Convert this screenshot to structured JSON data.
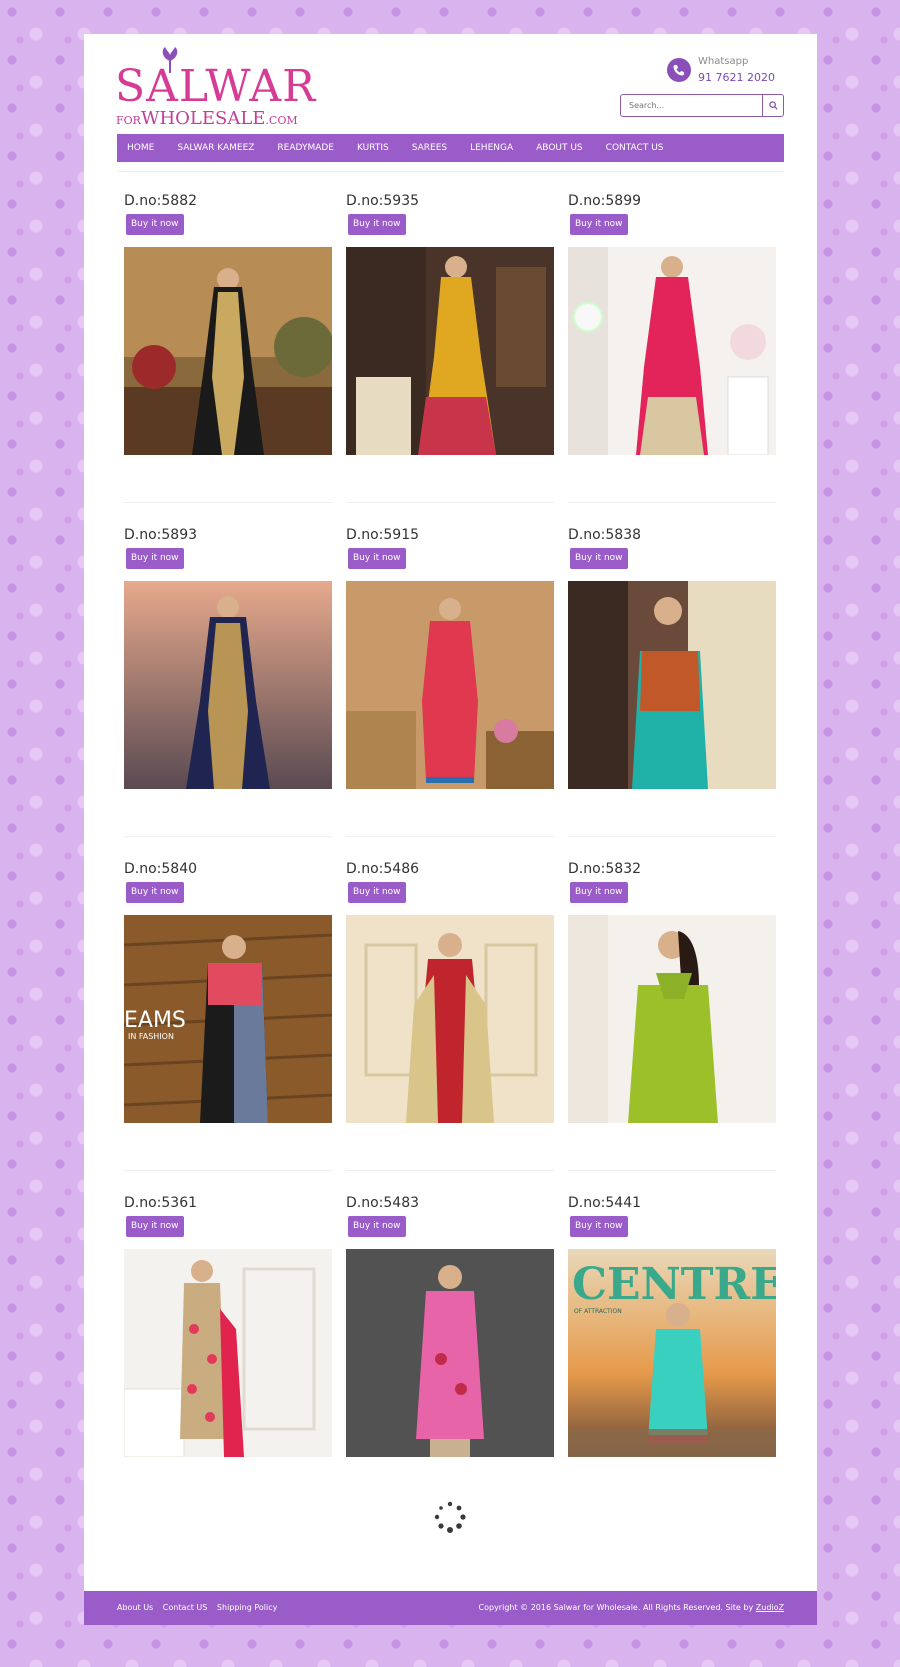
{
  "brand": {
    "logo_main": "SALWAR",
    "logo_prefix": "FOR",
    "logo_sub": "WHOLESALE",
    "logo_suffix": ".COM"
  },
  "contact": {
    "label": "Whatsapp",
    "number": "91 7621 2020"
  },
  "search": {
    "placeholder": "Search..."
  },
  "nav": {
    "items": [
      {
        "label": "HOME"
      },
      {
        "label": "SALWAR KAMEEZ"
      },
      {
        "label": "READYMADE"
      },
      {
        "label": "KURTIS"
      },
      {
        "label": "SAREES"
      },
      {
        "label": "LEHENGA"
      },
      {
        "label": "ABOUT US"
      },
      {
        "label": "CONTACT US"
      }
    ]
  },
  "buy_label": "Buy it now",
  "products": [
    {
      "title": "D.no:5882"
    },
    {
      "title": "D.no:5935"
    },
    {
      "title": "D.no:5899"
    },
    {
      "title": "D.no:5893"
    },
    {
      "title": "D.no:5915"
    },
    {
      "title": "D.no:5838"
    },
    {
      "title": "D.no:5840",
      "overlay_text": "EAMS",
      "overlay_sub": "IN FASHION"
    },
    {
      "title": "D.no:5486"
    },
    {
      "title": "D.no:5832"
    },
    {
      "title": "D.no:5361"
    },
    {
      "title": "D.no:5483"
    },
    {
      "title": "D.no:5441",
      "overlay_text": "CENTRE",
      "overlay_sub": "OF ATTRACTION"
    }
  ],
  "footer": {
    "links": [
      "About Us",
      "Contact US",
      "Shipping Policy"
    ],
    "copyright": "Copyright © 2016 Salwar for Wholesale. All Rights Reserved. Site by",
    "credit": "ZudioZ"
  },
  "colors": {
    "accent": "#9a5cc8",
    "logo_pink": "#d63c93"
  }
}
